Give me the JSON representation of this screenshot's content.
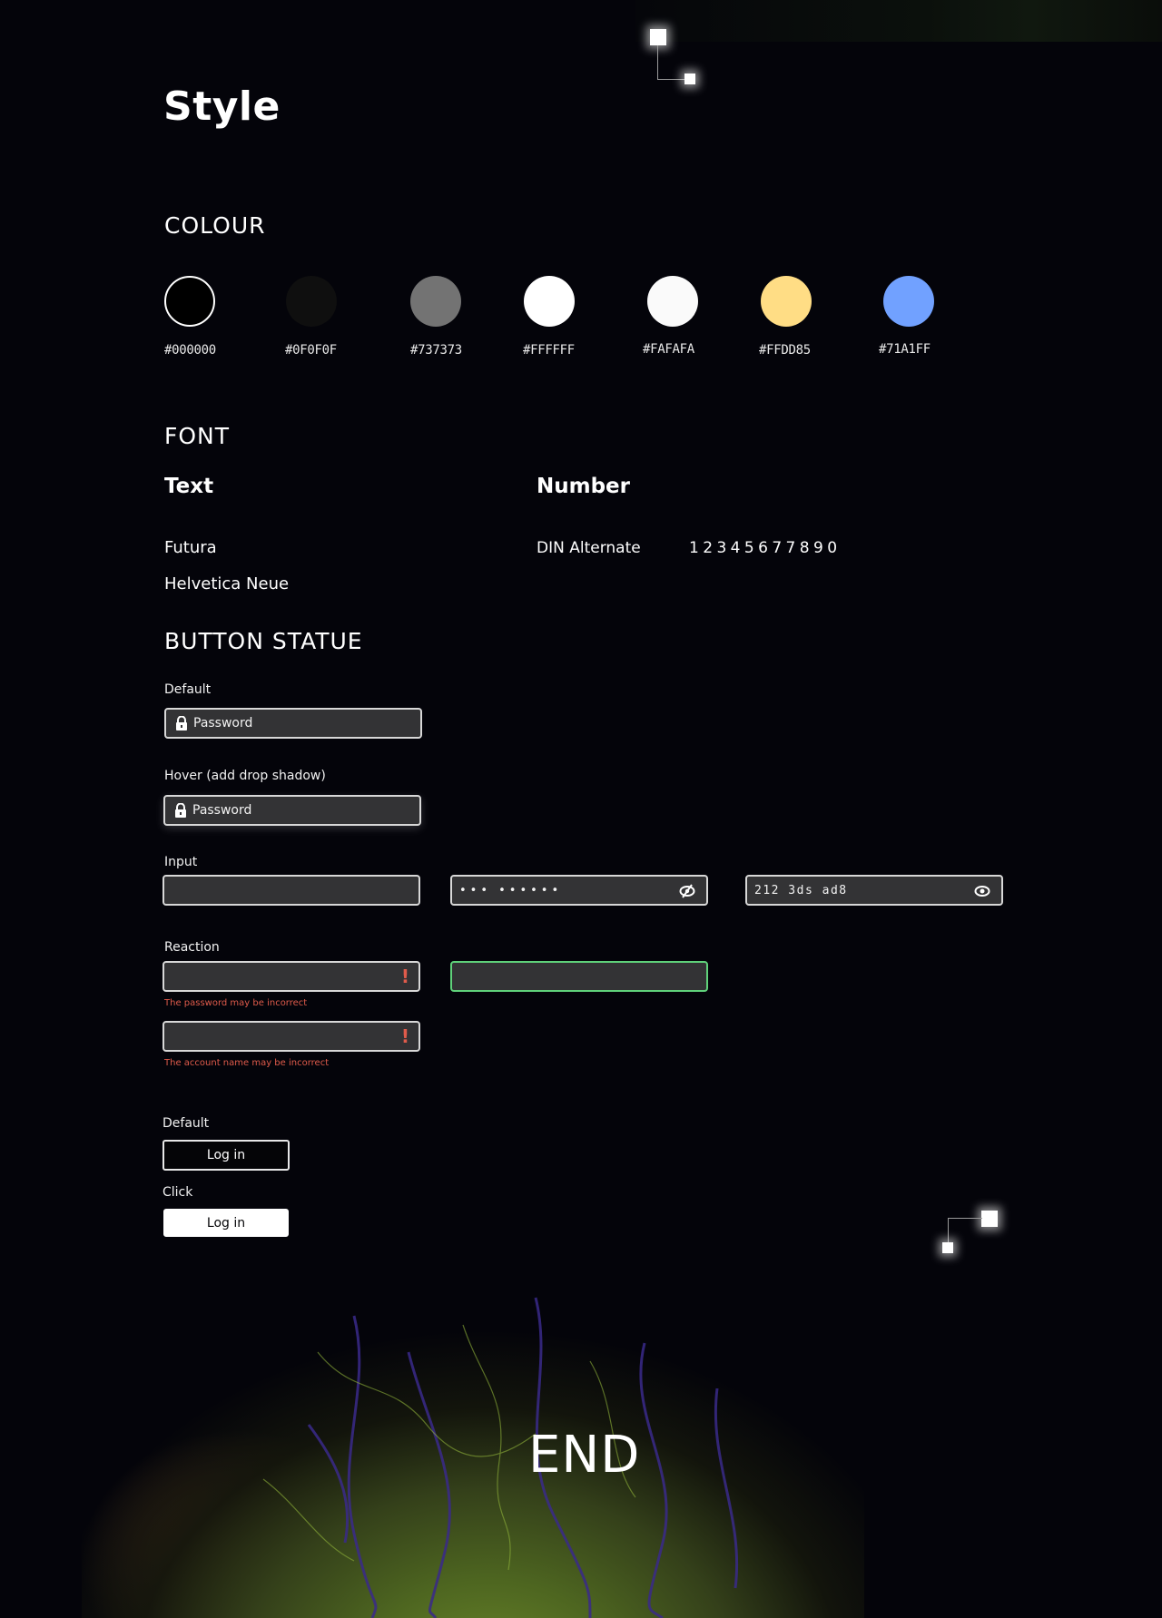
{
  "title": "Style",
  "colour": {
    "heading": "COLOUR",
    "swatches": [
      {
        "hex": "#000000",
        "label": "#000000"
      },
      {
        "hex": "#0F0F0F",
        "label": "#0F0F0F"
      },
      {
        "hex": "#737373",
        "label": "#737373"
      },
      {
        "hex": "#FFFFFF",
        "label": "#FFFFFF"
      },
      {
        "hex": "#FAFAFA",
        "label": "#FAFAFA"
      },
      {
        "hex": "#FFDD85",
        "label": "#FFDD85"
      },
      {
        "hex": "#71A1FF",
        "label": "#71A1FF"
      }
    ]
  },
  "font": {
    "heading": "FONT",
    "text_label": "Text",
    "number_label": "Number",
    "text_fonts": [
      "Futura",
      "Helvetica Neue"
    ],
    "number_font": "DIN Alternate",
    "number_sample": "1 2 3 4 5 6 7 7 8 9 0"
  },
  "button_statue": {
    "heading": "BUTTON STATUE",
    "default_label": "Default",
    "default_placeholder": "Password",
    "hover_label": "Hover (add drop shadow)",
    "hover_placeholder": "Password",
    "input_label": "Input",
    "password_masked": "•••  ••••••",
    "password_revealed": "212 3ds ad8",
    "reaction_label": "Reaction",
    "error_password": "The password may be incorrect",
    "error_account": "The account name may be incorrect",
    "error_mark": "!",
    "button_default_label": "Default",
    "button_click_label": "Click",
    "login_label": "Log in"
  },
  "footer": {
    "end_text": "END"
  },
  "icons": {
    "lock": "lock-icon",
    "eye": "eye-icon",
    "eye_off": "eye-off-icon",
    "alert": "exclamation-icon"
  },
  "colors": {
    "background": "#04040a",
    "field_bg": "#333335",
    "error": "#e05b4b",
    "valid": "#5fd17a"
  }
}
